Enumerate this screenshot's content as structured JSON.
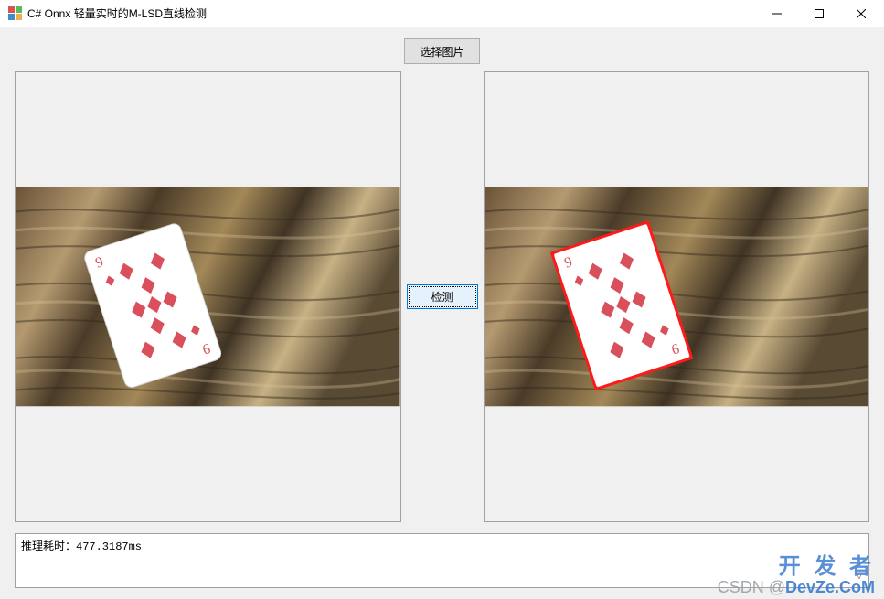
{
  "window": {
    "title": "C# Onnx 轻量实时的M-LSD直线检测",
    "minimize_label": "Minimize",
    "maximize_label": "Maximize",
    "close_label": "Close"
  },
  "buttons": {
    "select_image": "选择图片",
    "detect": "检测"
  },
  "content": {
    "card_rank": "9",
    "card_suit": "diamonds"
  },
  "status": {
    "text": "推理耗时：477.3187ms"
  },
  "watermark": {
    "line1": "开 发 者",
    "line2_prefix": "CSDN @",
    "line2_brand": "DevZe.CoM"
  }
}
